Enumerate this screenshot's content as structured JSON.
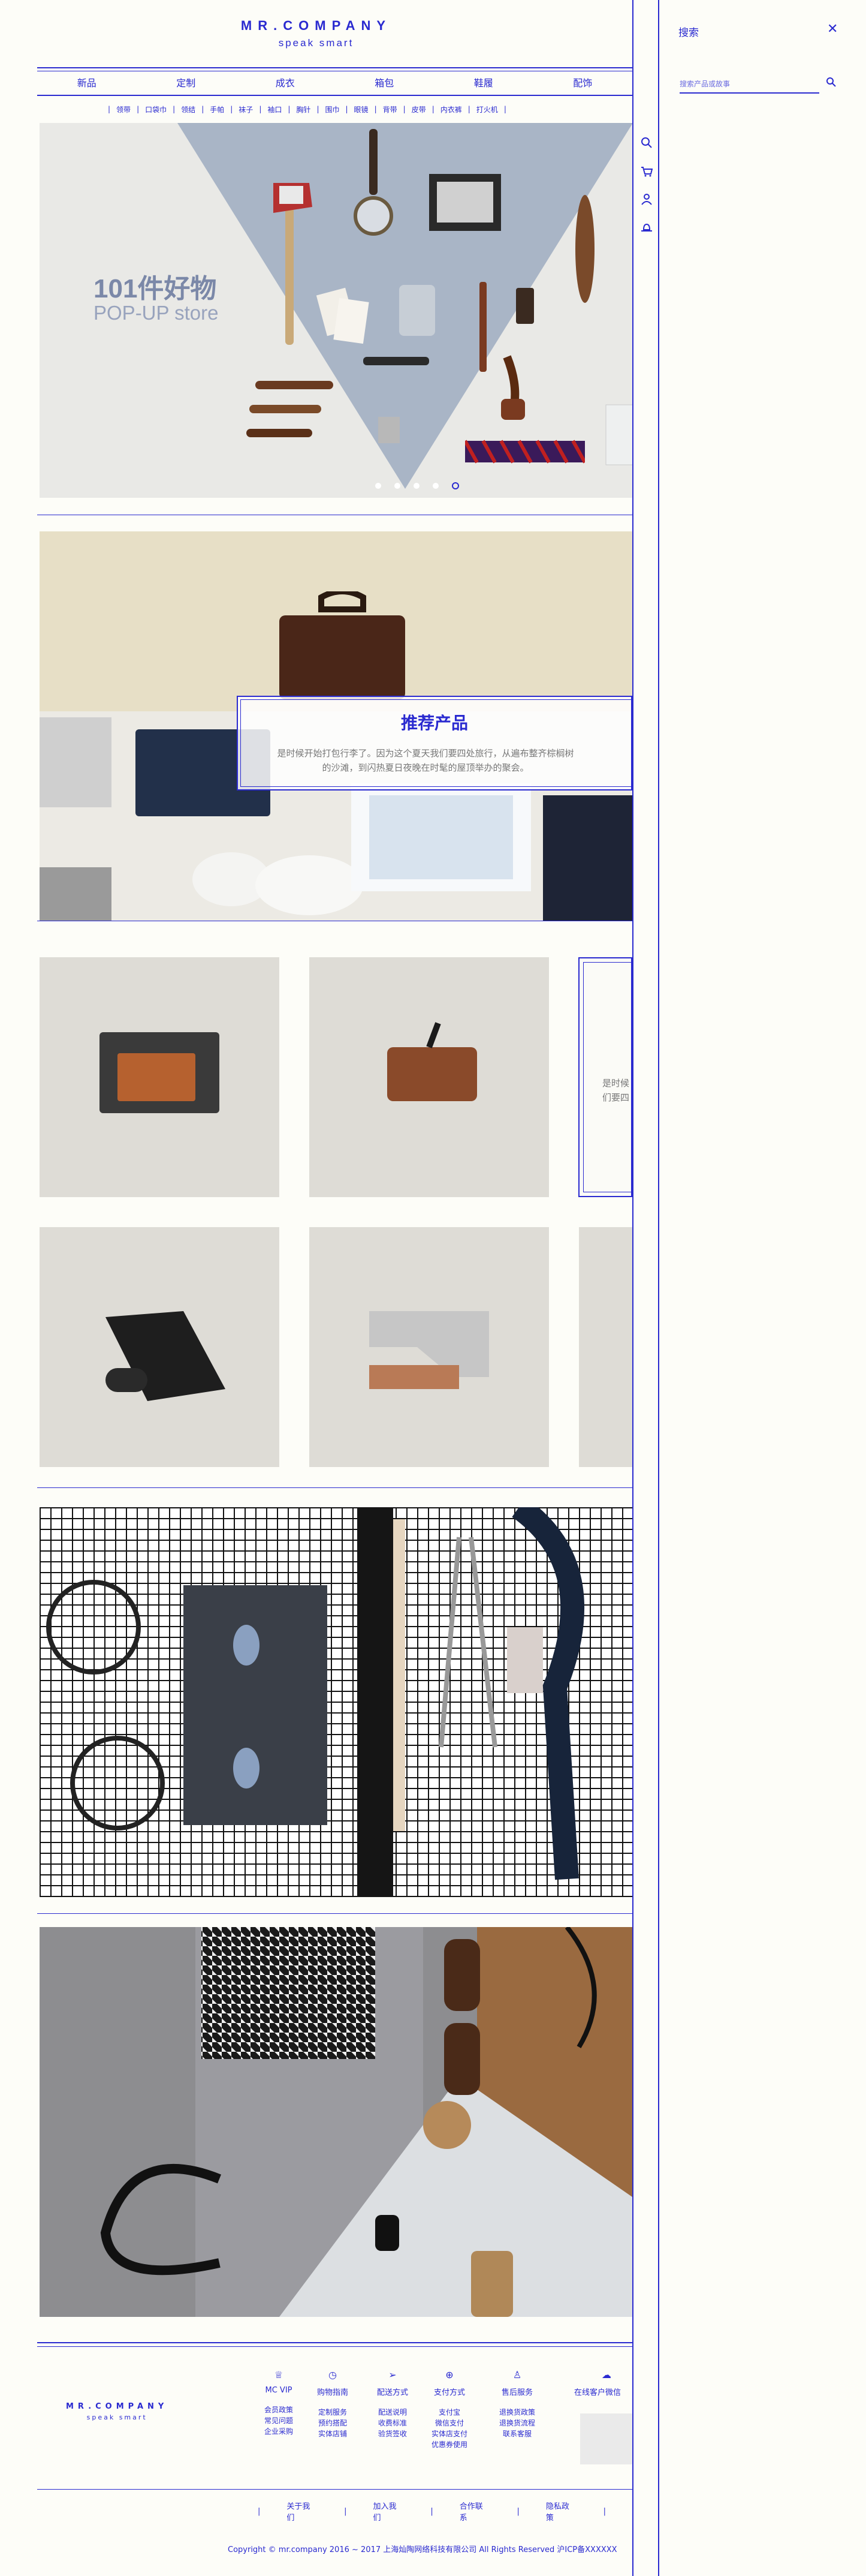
{
  "brand": {
    "name": "MR.COMPANY",
    "slogan": "speak smart"
  },
  "nav": [
    "新品",
    "定制",
    "成衣",
    "箱包",
    "鞋履",
    "配饰"
  ],
  "subnav": [
    "领带",
    "口袋巾",
    "领结",
    "手帕",
    "袜子",
    "袖口",
    "胸针",
    "围巾",
    "眼镜",
    "背带",
    "皮带",
    "内衣裤",
    "打火机"
  ],
  "hero": {
    "title": "101件好物",
    "subtitle": "POP-UP store",
    "slide_count": 5,
    "active_slide": 5
  },
  "recommend": {
    "title": "推荐产品",
    "text": "是时候开始打包行李了。因为这个夏天我们要四处旅行，从遍布整齐棕榈树的沙滩，到闪热夏日夜晚在时髦的屋顶举办的聚会。"
  },
  "product_card_partial_text": "是时候\n们要四",
  "footer": {
    "columns": [
      {
        "icon": "trophy-icon",
        "title": "MC VIP",
        "links": [
          "会员政策",
          "常见问题",
          "企业采购"
        ]
      },
      {
        "icon": "clock-icon",
        "title": "购物指南",
        "links": [
          "定制服务",
          "预约搭配",
          "实体店铺"
        ]
      },
      {
        "icon": "send-icon",
        "title": "配送方式",
        "links": [
          "配送说明",
          "收费标准",
          "验货签收"
        ]
      },
      {
        "icon": "payment-icon",
        "title": "支付方式",
        "links": [
          "支付宝",
          "微信支付",
          "实体店支付",
          "优惠券使用"
        ]
      },
      {
        "icon": "service-icon",
        "title": "售后服务",
        "links": [
          "退换货政策",
          "退换货流程",
          "联系客服"
        ]
      },
      {
        "icon": "wechat-icon",
        "title": "在线客户微信",
        "links": []
      }
    ],
    "links": [
      "关于我们",
      "加入我们",
      "合作联系",
      "隐私政策"
    ],
    "copyright": "Copyright © mr.company 2016 ~ 2017 上海灿陶网络科技有限公司  All Rights Reserved   沪ICP备XXXXXX"
  },
  "rail_icons": [
    "search-icon",
    "cart-icon",
    "user-icon",
    "hat-icon"
  ],
  "search_panel": {
    "title": "搜索",
    "placeholder": "搜索产品或故事",
    "close": "✕"
  },
  "colors": {
    "accent": "#2a2ad0",
    "background": "#fdfdf8"
  }
}
